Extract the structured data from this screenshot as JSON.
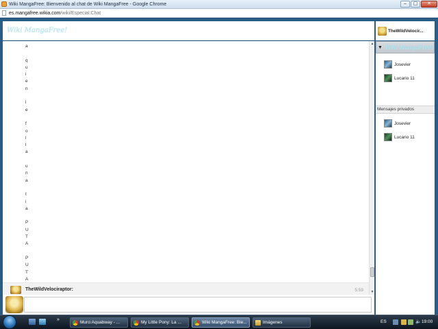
{
  "window": {
    "title": "Wiki MangaFree: Bienvenido al chat de Wiki MangaFree - Google Chrome",
    "controls": [
      "–",
      "▢",
      "✕"
    ]
  },
  "address_bar": {
    "host": "es.mangafree.wikia.com",
    "path": "/wiki/Especial:Chat"
  },
  "chat": {
    "wiki_logo": "Wiki MangaFree!",
    "current_user": "TheWildVelocir...",
    "message_lines": [
      "a",
      "",
      "q",
      "u",
      "i",
      "e",
      "n",
      "",
      "l",
      "e",
      "",
      "f",
      "o",
      "l",
      "l",
      "a",
      "",
      "u",
      "n",
      "a",
      "",
      "t",
      "i",
      "a",
      "",
      "P",
      "U",
      "T",
      "A",
      "",
      "P",
      "U",
      "T",
      "A"
    ],
    "last_message": {
      "author": "TheWildVelociraptor:",
      "time": "5:59"
    }
  },
  "sidebar": {
    "room_name": "Wiki MangaFree!",
    "room_toggle_icon": "triangle-down-icon",
    "users": [
      {
        "name": "Josevier",
        "avatar": "blue"
      },
      {
        "name": "Lucario 11",
        "avatar": "green"
      }
    ],
    "private_messages_header": "Mensajes privados",
    "private_users": [
      {
        "name": "Josevier",
        "avatar": "blue"
      },
      {
        "name": "Lucario 11",
        "avatar": "green"
      }
    ]
  },
  "taskbar": {
    "quick_launch_more": "»",
    "tasks": [
      {
        "label": "Muro:Aquabway - ...",
        "icon": "chrome-icon",
        "active": false
      },
      {
        "label": "My Little Pony: La ...",
        "icon": "chrome-icon",
        "active": false
      },
      {
        "label": "Wiki MangaFree: Bie...",
        "icon": "chrome-icon",
        "active": true
      },
      {
        "label": "Imágenes",
        "icon": "folder-icon",
        "active": false
      }
    ],
    "language": "ES",
    "volume_icon": "🔈",
    "time": "19:00"
  }
}
